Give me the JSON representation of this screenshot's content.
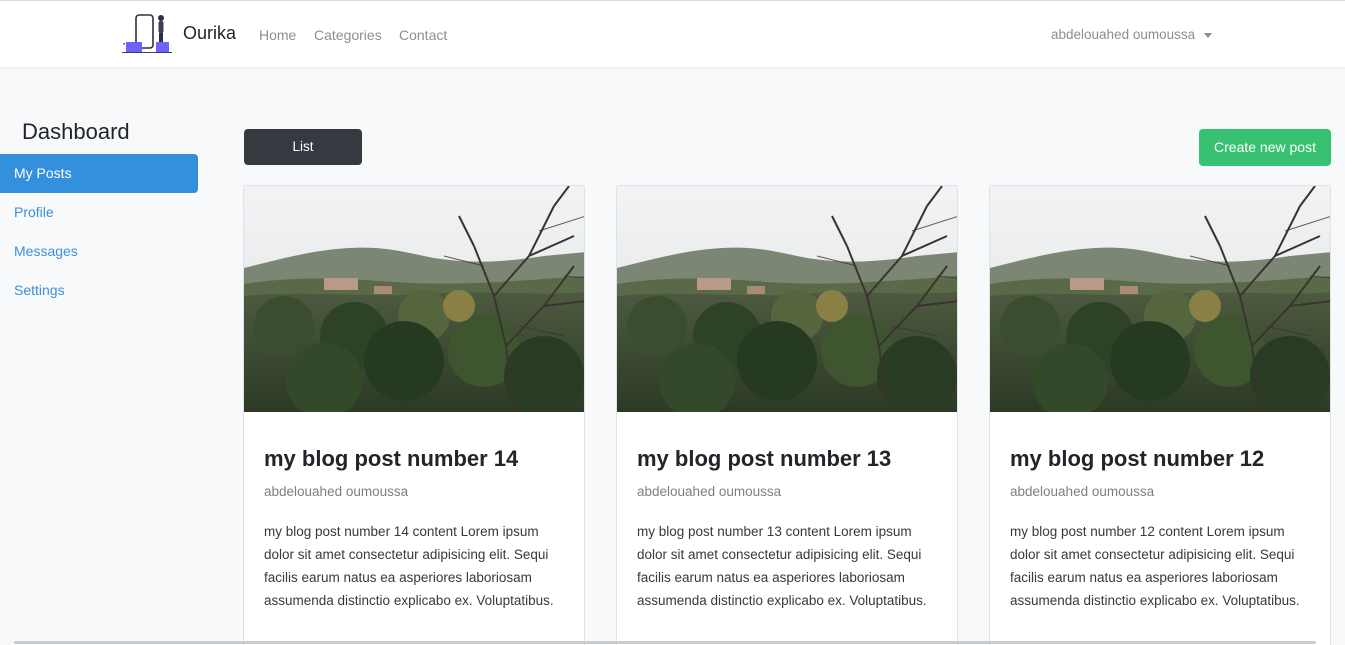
{
  "navbar": {
    "brand": "Ourika",
    "links": [
      "Home",
      "Categories",
      "Contact"
    ],
    "user": "abdelouahed oumoussa"
  },
  "sidebar": {
    "title": "Dashboard",
    "items": [
      {
        "label": "My Posts",
        "active": true
      },
      {
        "label": "Profile",
        "active": false
      },
      {
        "label": "Messages",
        "active": false
      },
      {
        "label": "Settings",
        "active": false
      }
    ]
  },
  "actions": {
    "list_label": "List",
    "create_label": "Create new post"
  },
  "posts": [
    {
      "title": "my blog post number 14",
      "author": "abdelouahed oumoussa",
      "content": "my blog post number 14 content Lorem ipsum dolor sit amet consectetur adipisicing elit. Sequi facilis earum natus ea asperiores laboriosam assumenda distinctio explicabo ex. Voluptatibus."
    },
    {
      "title": "my blog post number 13",
      "author": "abdelouahed oumoussa",
      "content": "my blog post number 13 content Lorem ipsum dolor sit amet consectetur adipisicing elit. Sequi facilis earum natus ea asperiores laboriosam assumenda distinctio explicabo ex. Voluptatibus."
    },
    {
      "title": "my blog post number 12",
      "author": "abdelouahed oumoussa",
      "content": "my blog post number 12 content Lorem ipsum dolor sit amet consectetur adipisicing elit. Sequi facilis earum natus ea asperiores laboriosam assumenda distinctio explicabo ex. Voluptatibus."
    }
  ],
  "colors": {
    "primary": "#3490dc",
    "success": "#38c172",
    "dark": "#343a40"
  },
  "icons": {
    "brand_logo": "phone-person-logo-icon",
    "user_caret": "caret-down-icon"
  }
}
